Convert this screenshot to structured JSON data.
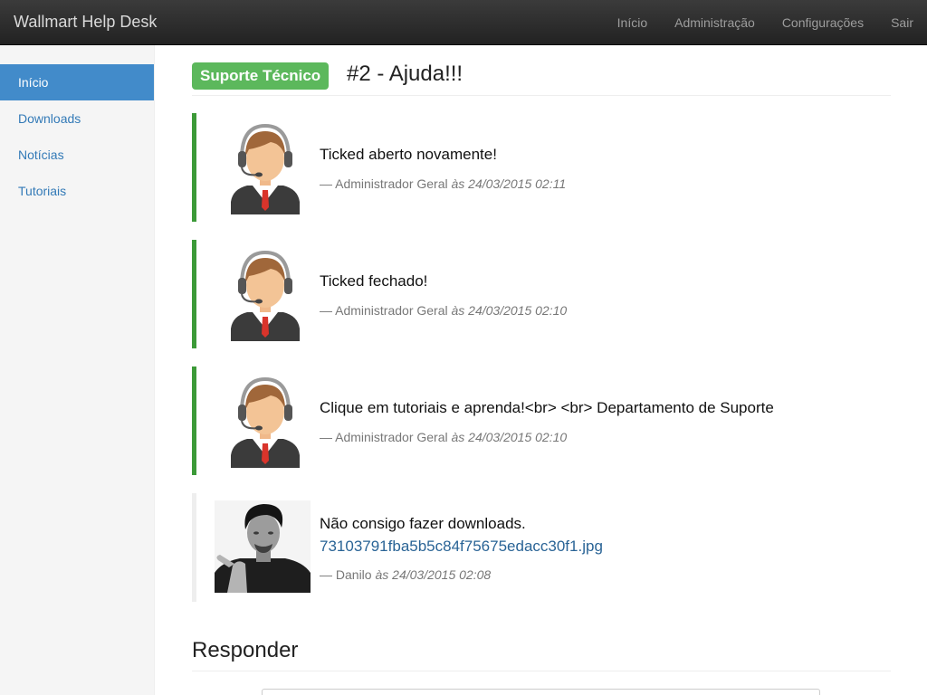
{
  "app": {
    "brand": "Wallmart Help Desk",
    "nav": [
      "Início",
      "Administração",
      "Configurações",
      "Sair"
    ]
  },
  "sidebar": {
    "items": [
      "Início",
      "Downloads",
      "Notícias",
      "Tutoriais"
    ],
    "active_index": 0
  },
  "ticket": {
    "category": "Suporte Técnico",
    "title": "#2 - Ajuda!!!",
    "category_color": "#5cb85c"
  },
  "messages": [
    {
      "text": "Ticked aberto novamente!",
      "author": "— Administrador Geral",
      "date": "às 24/03/2015 02:11",
      "avatar_icon": "support-agent-avatar",
      "accent": "#3c9a38"
    },
    {
      "text": "Ticked fechado!",
      "author": "— Administrador Geral",
      "date": "às 24/03/2015 02:10",
      "avatar_icon": "support-agent-avatar",
      "accent": "#3c9a38"
    },
    {
      "text": "Clique em tutoriais e aprenda!<br> <br> Departamento de Suporte",
      "author": "— Administrador Geral",
      "date": "às 24/03/2015 02:10",
      "avatar_icon": "support-agent-avatar",
      "accent": "#3c9a38"
    },
    {
      "text": "Não consigo fazer downloads.",
      "attachment": "73103791fba5b5c84f75675edacc30f1.jpg",
      "author": "— Danilo",
      "date": "às 24/03/2015 02:08",
      "avatar_icon": "user-photo",
      "accent": "#eeeeee"
    }
  ],
  "reply": {
    "title": "Responder"
  }
}
